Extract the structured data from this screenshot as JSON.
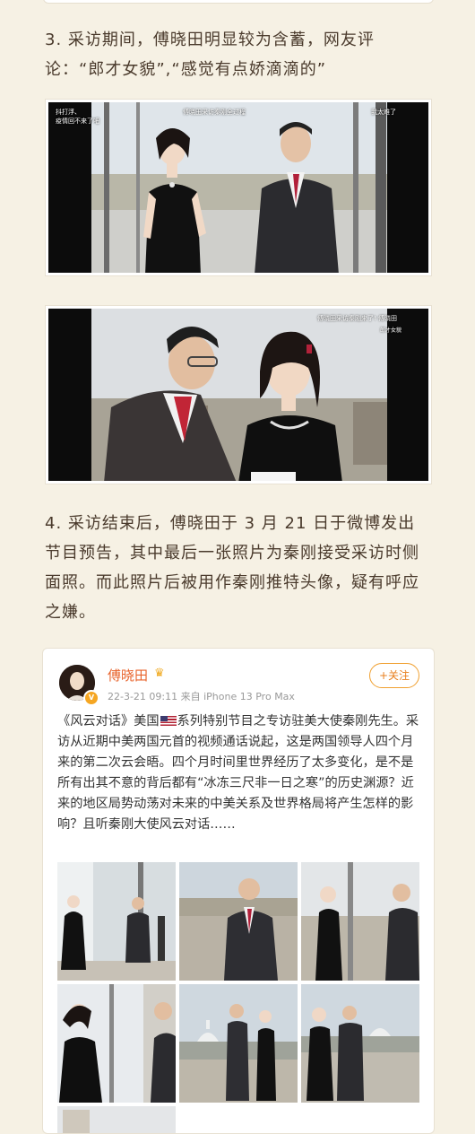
{
  "article": {
    "section3_text": "3. 采访期间，傅晓田明显较为含蓄，网友评论：“郎才女貌”,“感觉有点娇滴滴的”",
    "section4_text": "4. 采访结束后，傅晓田于 3 月 21 日于微博发出节目预告，其中最后一张照片为秦刚接受采访时侧面照。而此照片后被用作秦刚推特头像，疑有呼应之嫌。"
  },
  "video1": {
    "overlay_left": "抖打浮、\n疫情回不来了吧",
    "overlay_center": "傅晓田采访秦刚全过程",
    "overlay_right": "我太难了"
  },
  "video2": {
    "overlay_top": "傅晓田采访秦刚来了! 傅晓田",
    "overlay_tag": "郎才女貌"
  },
  "weibo": {
    "user_name": "傅晓田",
    "meta": "22-3-21 09:11  来自 iPhone 13 Pro Max",
    "follow_label": "+关注",
    "post_text_part1": "《风云对话》美国",
    "post_text_part2": "系列特别节目之专访驻美大使秦刚先生。采访从近期中美两国元首的视频通话说起，这是两国领导人四个月来的第二次云会晤。四个月时间里世界经历了太多变化，是不是所有出其不意的背后都有“冰冻三尺非一日之寒”的历史渊源？近来的地区局势动荡对未来的中美关系及世界格局将产生怎样的影响？且听秦刚大使风云对话……",
    "flag_icon": "us-flag-emoji"
  }
}
